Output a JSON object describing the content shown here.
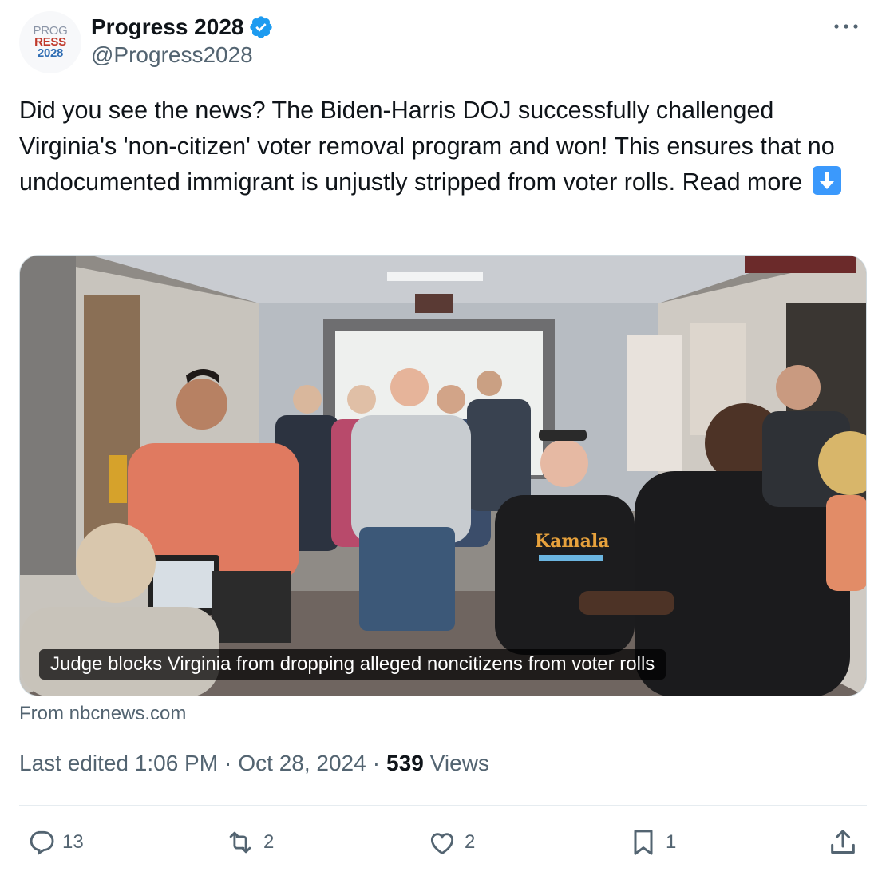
{
  "author": {
    "avatar_text": [
      "PROG",
      "RESS",
      "2028"
    ],
    "display_name": "Progress 2028",
    "handle": "@Progress2028",
    "verified_icon": "verified-badge-icon"
  },
  "tweet": {
    "text": "Did you see the news? The Biden-Harris DOJ successfully challenged Virginia's 'non-citizen' voter removal program and won!  This ensures that no undocumented immigrant is unjustly stripped from voter rolls. Read more",
    "emoji": "down-arrow-emoji"
  },
  "link_card": {
    "caption": "Judge blocks Virginia from dropping alleged noncitizens from voter rolls",
    "source": "From nbcnews.com",
    "shirt_text": "Kamala"
  },
  "meta": {
    "edited_label": "Last edited 1:06 PM",
    "date": "Oct 28, 2024",
    "separator": "·",
    "views_count": "539",
    "views_label": "Views"
  },
  "actions": {
    "replies": "13",
    "reposts": "2",
    "likes": "2",
    "bookmarks": "1"
  },
  "colors": {
    "text": "#0f1419",
    "secondary": "#536471",
    "verified": "#1d9bf0",
    "border": "#cfd9de"
  }
}
